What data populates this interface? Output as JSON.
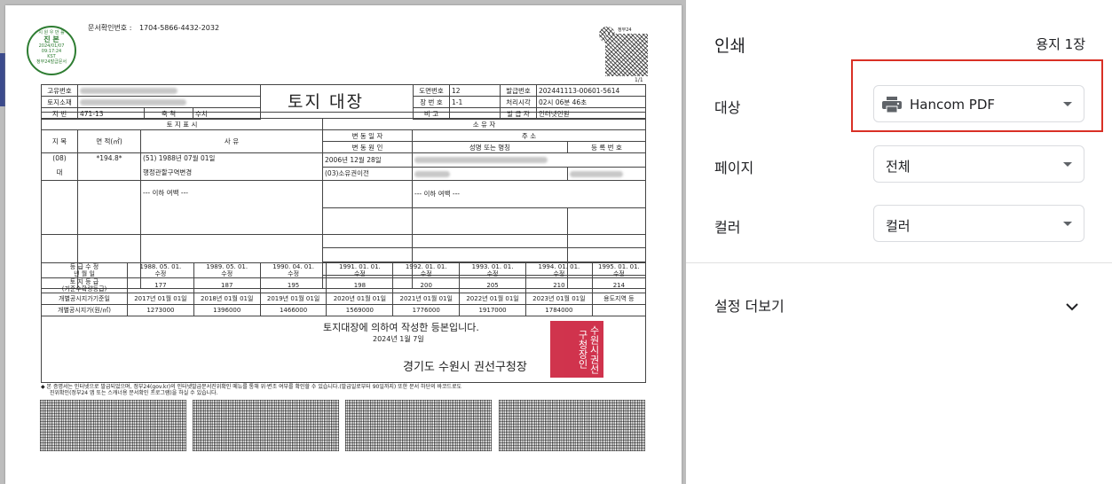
{
  "doc": {
    "confirm_label": "문서확인번호 :",
    "confirm_no": "1704-5866-4432-2032",
    "stamp_lines": [
      "시 원 우 만 를",
      "진 본",
      "2024/01/07",
      "09:17:24",
      "KST",
      "정부24발급문서"
    ],
    "qr_caption": "정부24",
    "page_marker": "1/1",
    "title": "토지 대장",
    "hdr": {
      "owner_id_label": "고유번호",
      "location_label": "토지소재",
      "lot_label": "지 번",
      "lot_value": "471-13",
      "scale_label": "축 척",
      "scale_value": "수치",
      "map_no_label": "도면번호",
      "map_no_value": "12",
      "sheet_no_label": "장 번 호",
      "sheet_no_value": "1-1",
      "note_label": "비 고",
      "issue_no_label": "발급번호",
      "issue_no_value": "202441113-00601-5614",
      "proc_time_label": "처리시각",
      "proc_time_value": "02시 06분 46초",
      "issuer_label": "발 급 자",
      "issuer_value": "인터넷민원"
    },
    "land_section": "토 지 표 시",
    "owner_section": "소 유 자",
    "col_jimok": "지 목",
    "col_area": "면 적(㎡)",
    "col_reason": "사 유",
    "col_change_date": "변 동 일 자",
    "col_change_cause": "변 동 원 인",
    "col_address": "주 소",
    "col_name": "성명 또는 명칭",
    "col_regno": "등 록 번 호",
    "row_jimok_code": "(08)",
    "row_jimok_name": "대",
    "row_area": "*194.8*",
    "row_reason_1": "(51) 1988년 07월 01일",
    "row_reason_2": "행정관할구역변경",
    "row_change_date": "2006년 12월 28일",
    "row_change_cause": "(03)소유권이전",
    "blank_mark": "--- 이하 여백 ---",
    "grade_label_1": "등 급 수 정",
    "grade_label_2": "년 월 일",
    "grade_dates": [
      "1988. 05. 01.",
      "1989. 05. 01.",
      "1990. 04. 01.",
      "1991. 01. 01.",
      "1992. 01. 01.",
      "1993. 01. 01.",
      "1994. 01. 01.",
      "1995. 01. 01."
    ],
    "grade_suffix": "수정",
    "land_grade_label_1": "토 지 등 급",
    "land_grade_label_2": "(기준수확량등급)",
    "land_grades": [
      "177",
      "187",
      "195",
      "198",
      "200",
      "205",
      "210",
      "214"
    ],
    "price_date_label": "개별공시지가기준일",
    "price_dates": [
      "2017년 01월 01일",
      "2018년 01월 01일",
      "2019년 01월 01일",
      "2020년 01월 01일",
      "2021년 01월 01일",
      "2022년 01월 01일",
      "2023년 01월 01일",
      "용도지역 등"
    ],
    "price_label": "개별공시지가(원/㎡)",
    "prices": [
      "1273000",
      "1396000",
      "1466000",
      "1569000",
      "1776000",
      "1917000",
      "1784000",
      ""
    ],
    "cert_text": "토지대장에 의하여 작성한 등본입니다.",
    "cert_date": "2024년 1월 7일",
    "cert_office": "경기도 수원시 권선구청장",
    "seal_text": "수원시권선구청장인",
    "footnote_1": "◆ 본 증명서는 인터넷으로 발급되었으며, 정부24(gov.kr)의 인터넷발급문서진위확인 메뉴를 통해 위·변조 여부를 확인할 수 있습니다.(발급일로부터 90일까지) 또한 문서 하단의 바코드로도",
    "footnote_2": "진위확인(정부24 앱 또는 스캐너용 문서확인 프로그램)을 하실 수 있습니다."
  },
  "panel": {
    "title": "인쇄",
    "sheet_count": "용지 1장",
    "dest_label": "대상",
    "dest_value": "Hancom PDF",
    "pages_label": "페이지",
    "pages_value": "전체",
    "color_label": "컬러",
    "color_value": "컬러",
    "more_label": "설정 더보기"
  },
  "colors": {
    "accent_red": "#d93025",
    "seal_red": "#c8102e",
    "stamp_green": "#2e7d32"
  }
}
